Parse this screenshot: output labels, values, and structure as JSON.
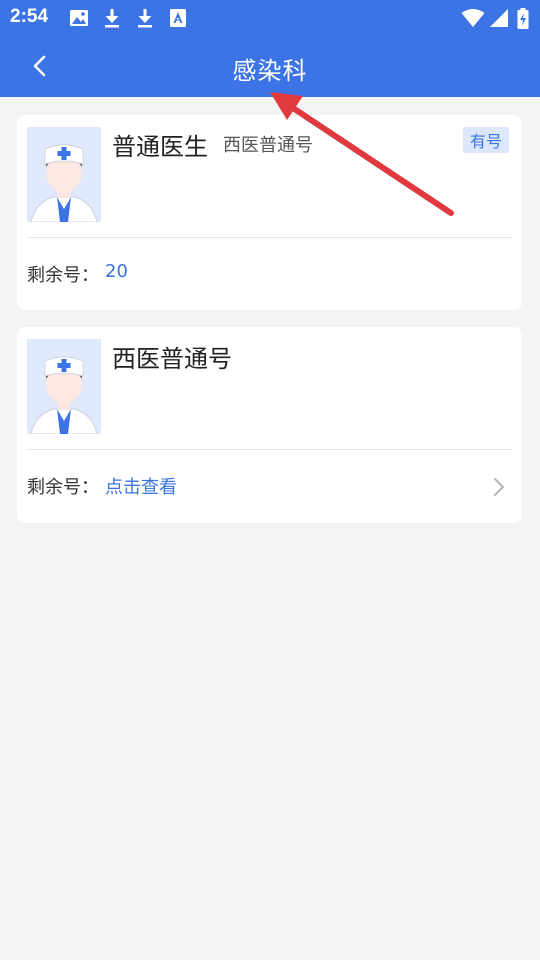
{
  "status_bar": {
    "time": "2:54",
    "icons": [
      "image-icon",
      "download-icon",
      "download-icon",
      "text-a-icon",
      "wifi-icon",
      "signal-icon",
      "battery-charging-icon"
    ]
  },
  "header": {
    "title": "感染科",
    "back_icon": "chevron-left-icon"
  },
  "cards": [
    {
      "name": "普通医生",
      "subtitle": "西医普通号",
      "badge": "有号",
      "remain_label": "剩余号：",
      "remain_value": "20",
      "avatar_icon": "doctor-avatar-icon"
    },
    {
      "name": "西医普通号",
      "remain_label": "剩余号：",
      "remain_value": "点击查看",
      "avatar_icon": "doctor-avatar-icon",
      "chevron_icon": "chevron-right-icon"
    }
  ],
  "colors": {
    "primary": "#3c74e6",
    "background": "#f3f5f4",
    "card": "#ffffff",
    "annotation_arrow": "#e03a3e"
  }
}
